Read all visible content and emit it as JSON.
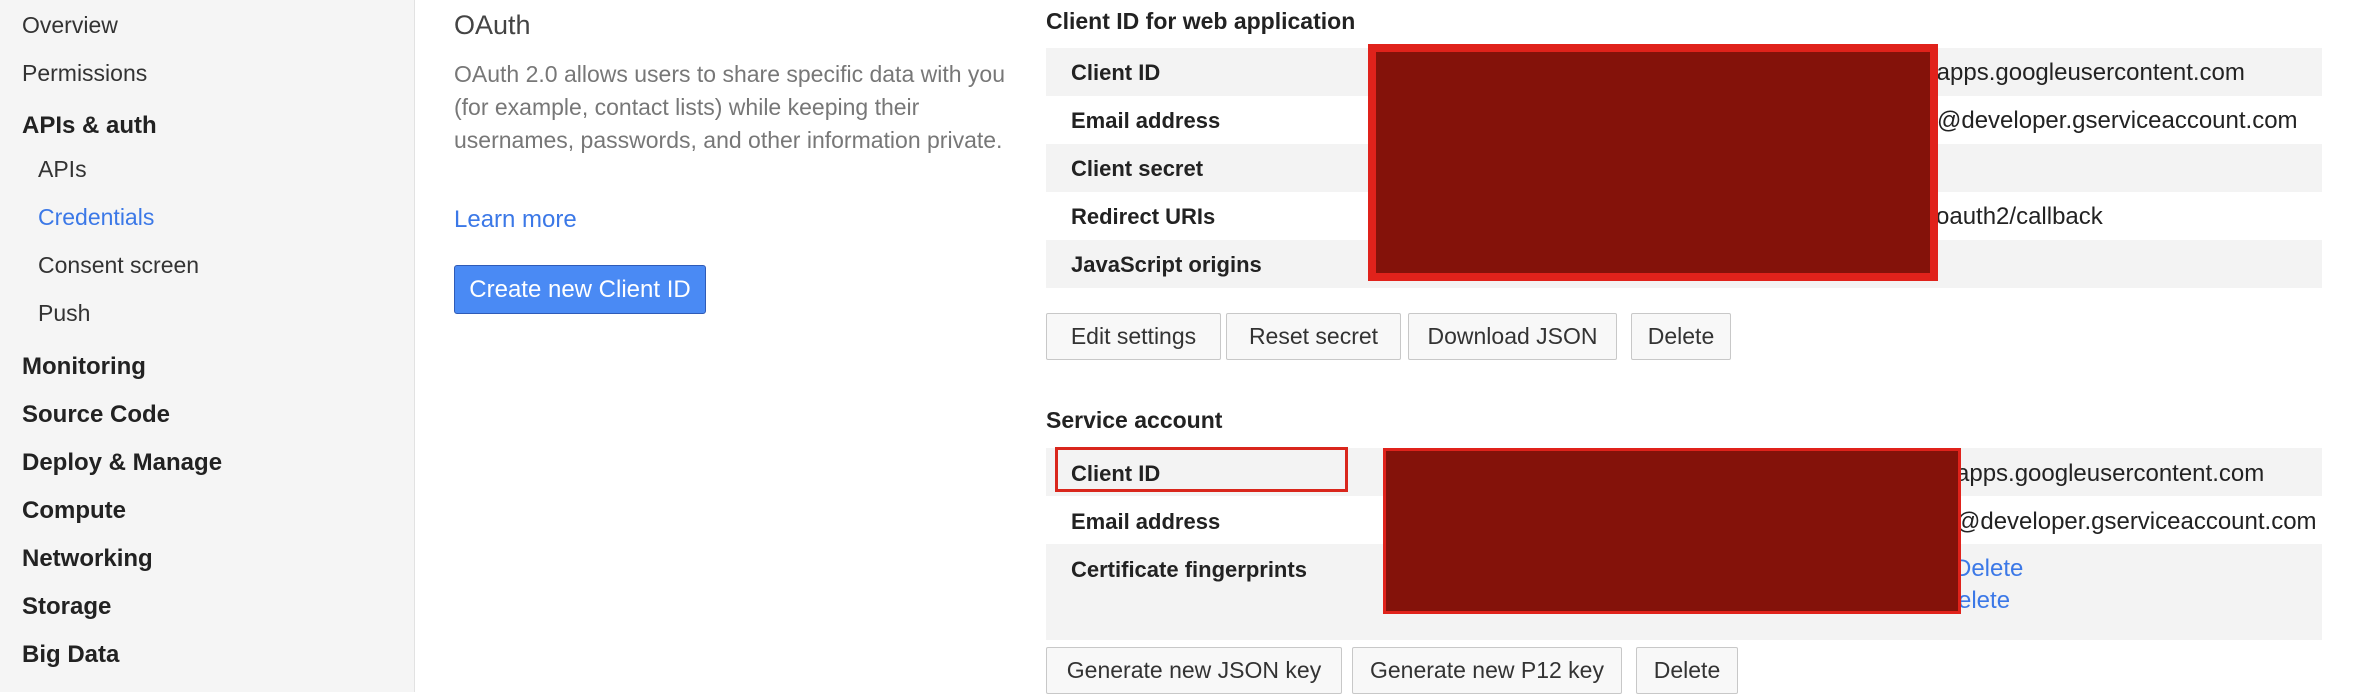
{
  "sidebar": {
    "top_items": [
      "Overview",
      "Permissions"
    ],
    "apis_auth": {
      "label": "APIs & auth",
      "children": [
        "APIs",
        "Credentials",
        "Consent screen",
        "Push"
      ],
      "active": "Credentials"
    },
    "sections": [
      "Monitoring",
      "Source Code",
      "Deploy & Manage",
      "Compute",
      "Networking",
      "Storage",
      "Big Data"
    ]
  },
  "oauth": {
    "title": "OAuth",
    "description": "OAuth 2.0 allows users to share specific data with you (for example, contact lists) while keeping their usernames, passwords, and other information private.",
    "learn_more": "Learn more",
    "create_button": "Create new Client ID"
  },
  "web_app": {
    "title": "Client ID for web application",
    "rows": [
      {
        "label": "Client ID",
        "value": ".apps.googleusercontent.com"
      },
      {
        "label": "Email address",
        "value": "@developer.gserviceaccount.com"
      },
      {
        "label": "Client secret",
        "value": ""
      },
      {
        "label": "Redirect URIs",
        "value": "oauth2/callback"
      },
      {
        "label": "JavaScript origins",
        "value": ""
      }
    ],
    "buttons": [
      "Edit settings",
      "Reset secret",
      "Download JSON",
      "Delete"
    ]
  },
  "service_account": {
    "title": "Service account",
    "rows": [
      {
        "label": "Client ID",
        "value": "apps.googleusercontent.com"
      },
      {
        "label": "Email address",
        "value": "@developer.gserviceaccount.com"
      },
      {
        "label": "Certificate fingerprints",
        "links": [
          "Delete",
          "elete"
        ]
      }
    ],
    "buttons": [
      "Generate new JSON key",
      "Generate new P12 key",
      "Delete"
    ]
  },
  "colors": {
    "accent": "#3b78e7",
    "primary_button": "#4a8af4",
    "redaction_fill": "#84120a",
    "redaction_border": "#e0221b"
  }
}
